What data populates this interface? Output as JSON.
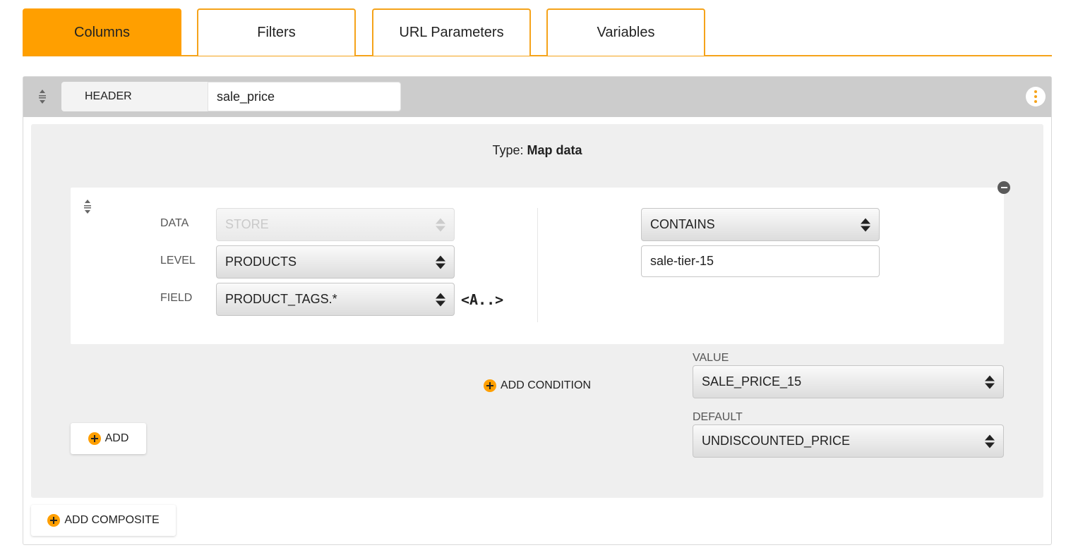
{
  "tabs": [
    {
      "label": "Columns",
      "active": true
    },
    {
      "label": "Filters",
      "active": false
    },
    {
      "label": "URL Parameters",
      "active": false
    },
    {
      "label": "Variables",
      "active": false
    }
  ],
  "header": {
    "label": "HEADER",
    "value": "sale_price"
  },
  "type": {
    "prefix": "Type:",
    "value": "Map data"
  },
  "condition": {
    "data_label": "DATA",
    "data_value": "STORE",
    "level_label": "LEVEL",
    "level_value": "PRODUCTS",
    "field_label": "FIELD",
    "field_value": "PRODUCT_TAGS.*",
    "macro": "<A..>",
    "operator": "CONTAINS",
    "match_value": "sale-tier-15"
  },
  "add_condition_label": "ADD CONDITION",
  "value_section": {
    "label": "VALUE",
    "selected": "SALE_PRICE_15"
  },
  "default_section": {
    "label": "DEFAULT",
    "selected": "UNDISCOUNTED_PRICE"
  },
  "add_label": "ADD",
  "add_composite_label": "ADD COMPOSITE",
  "colors": {
    "accent": "#ff9f00",
    "tab_border": "#f5a31a",
    "header_bg": "#cccccc",
    "inner_bg": "#efefef"
  },
  "icons": [
    "drag-handle-icon",
    "kebab-menu-icon",
    "remove-icon",
    "plus-icon",
    "select-arrows-icon"
  ]
}
